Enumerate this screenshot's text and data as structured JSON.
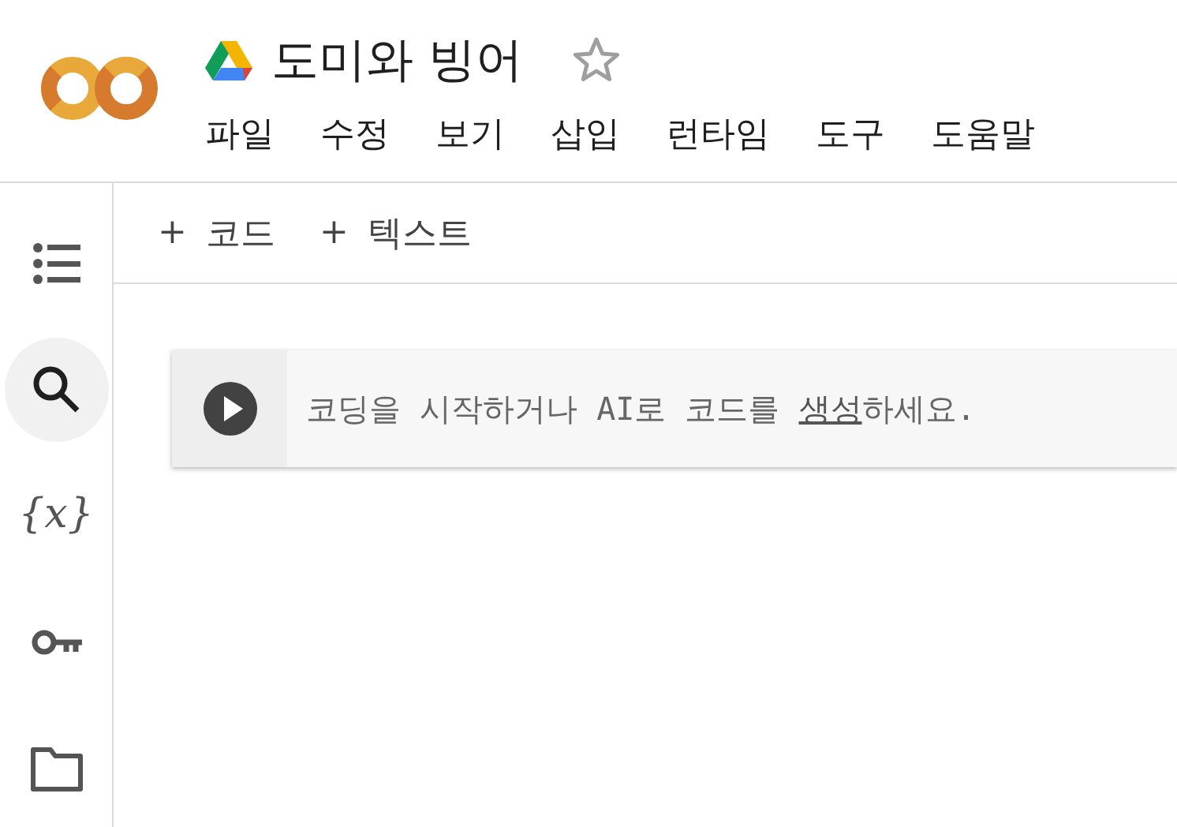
{
  "header": {
    "title": "도미와 빙어",
    "starred": false,
    "menu": [
      "파일",
      "수정",
      "보기",
      "삽입",
      "런타임",
      "도구",
      "도움말"
    ]
  },
  "sidebar": {
    "items": [
      {
        "kind": "toc",
        "selected": false
      },
      {
        "kind": "search",
        "selected": true
      },
      {
        "kind": "variables",
        "glyph": "{x}",
        "selected": false
      },
      {
        "kind": "secrets",
        "selected": false
      },
      {
        "kind": "files",
        "selected": false
      }
    ]
  },
  "toolbar": {
    "buttons": [
      {
        "icon": "+",
        "label": "코드"
      },
      {
        "icon": "+",
        "label": "텍스트"
      }
    ]
  },
  "cell": {
    "placeholder_before": "코딩을 시작하거나 AI로 코드를 ",
    "link": "생성",
    "placeholder_after": "하세요."
  }
}
